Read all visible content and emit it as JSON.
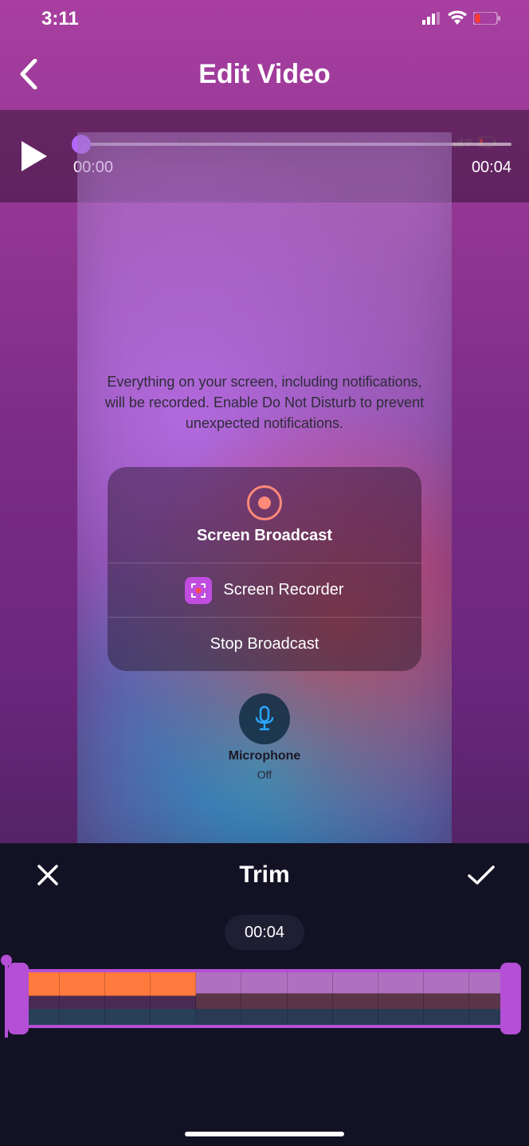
{
  "status": {
    "time": "3:11"
  },
  "nav": {
    "title": "Edit Video"
  },
  "player": {
    "start": "00:00",
    "end": "00:04",
    "inner_time": "3:09"
  },
  "preview": {
    "message": "Everything on your screen, including notifications, will be recorded. Enable Do Not Disturb to prevent unexpected notifications.",
    "sheet": {
      "broadcast_label": "Screen Broadcast",
      "app_label": "Screen Recorder",
      "stop_label": "Stop Broadcast"
    },
    "mic": {
      "title": "Microphone",
      "state": "Off"
    }
  },
  "trim": {
    "title": "Trim",
    "duration": "00:04"
  }
}
